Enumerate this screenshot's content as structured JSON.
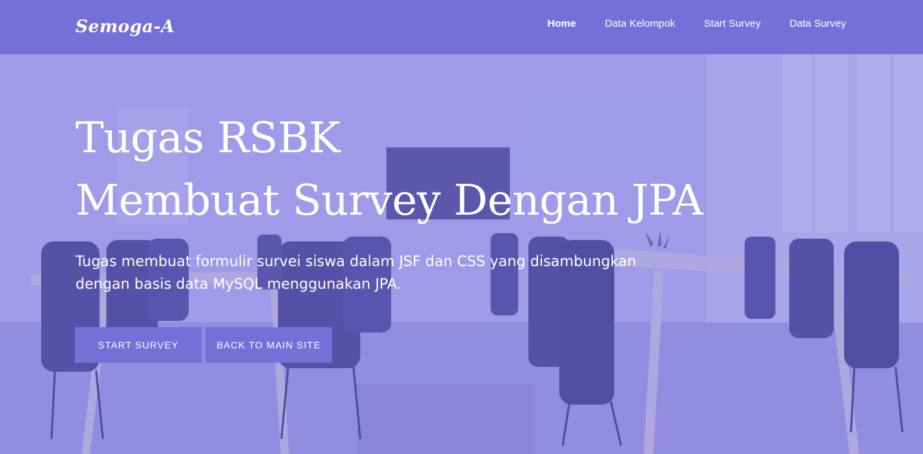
{
  "navbar": {
    "brand": "Semoga-A",
    "links": [
      {
        "label": "Home",
        "active": true
      },
      {
        "label": "Data Kelompok",
        "active": false
      },
      {
        "label": "Start Survey",
        "active": false
      },
      {
        "label": "Data Survey",
        "active": false
      }
    ]
  },
  "hero": {
    "title_line1": "Tugas RSBK",
    "title_line2": "Membuat Survey Dengan JPA",
    "subtitle": "Tugas membuat formulir survei siswa dalam JSF dan CSS yang disambungkan dengan basis data MySQL menggunakan JPA.",
    "buttons": {
      "primary": "Start Survey",
      "secondary": "Back to Main Site"
    }
  },
  "colors": {
    "accent": "#7470d8",
    "overlay": "#a8a2ec",
    "text": "#ffffff"
  }
}
